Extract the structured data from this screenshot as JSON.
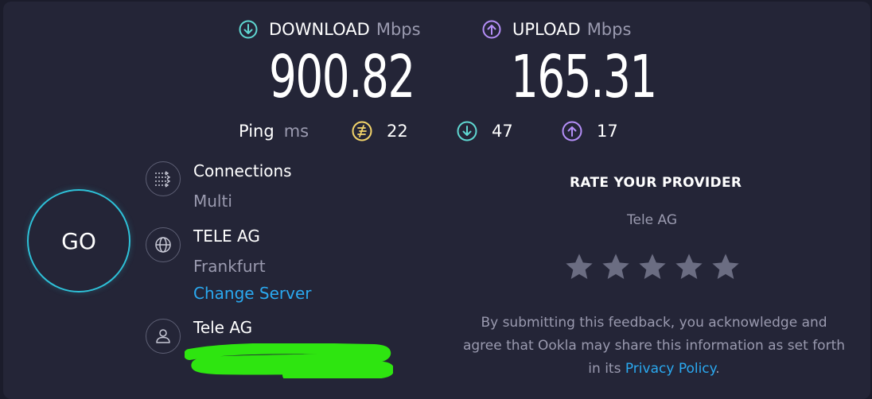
{
  "download": {
    "label": "DOWNLOAD",
    "unit": "Mbps",
    "value": "900.82",
    "color": "#5fd7d1"
  },
  "upload": {
    "label": "UPLOAD",
    "unit": "Mbps",
    "value": "165.31",
    "color": "#b48ef7"
  },
  "ping": {
    "label": "Ping",
    "unit": "ms",
    "idle": "22",
    "download": "47",
    "upload": "17",
    "idle_color": "#f3d46a"
  },
  "go_button": "GO",
  "connections": {
    "title": "Connections",
    "value": "Multi"
  },
  "server": {
    "name": "TELE AG",
    "location": "Frankfurt",
    "change_link": "Change Server"
  },
  "provider": {
    "name": "Tele AG"
  },
  "rate": {
    "title": "RATE YOUR PROVIDER",
    "provider": "Tele AG",
    "stars": 5,
    "disclaimer_prefix": "By submitting this feedback, you acknowledge and agree that Ookla may share this information as set forth in its ",
    "privacy_link": "Privacy Policy",
    "disclaimer_suffix": "."
  },
  "icons": [
    "download-arrow-icon",
    "upload-arrow-icon",
    "ping-idle-icon",
    "connections-icon",
    "globe-icon",
    "user-icon",
    "star-icon"
  ]
}
